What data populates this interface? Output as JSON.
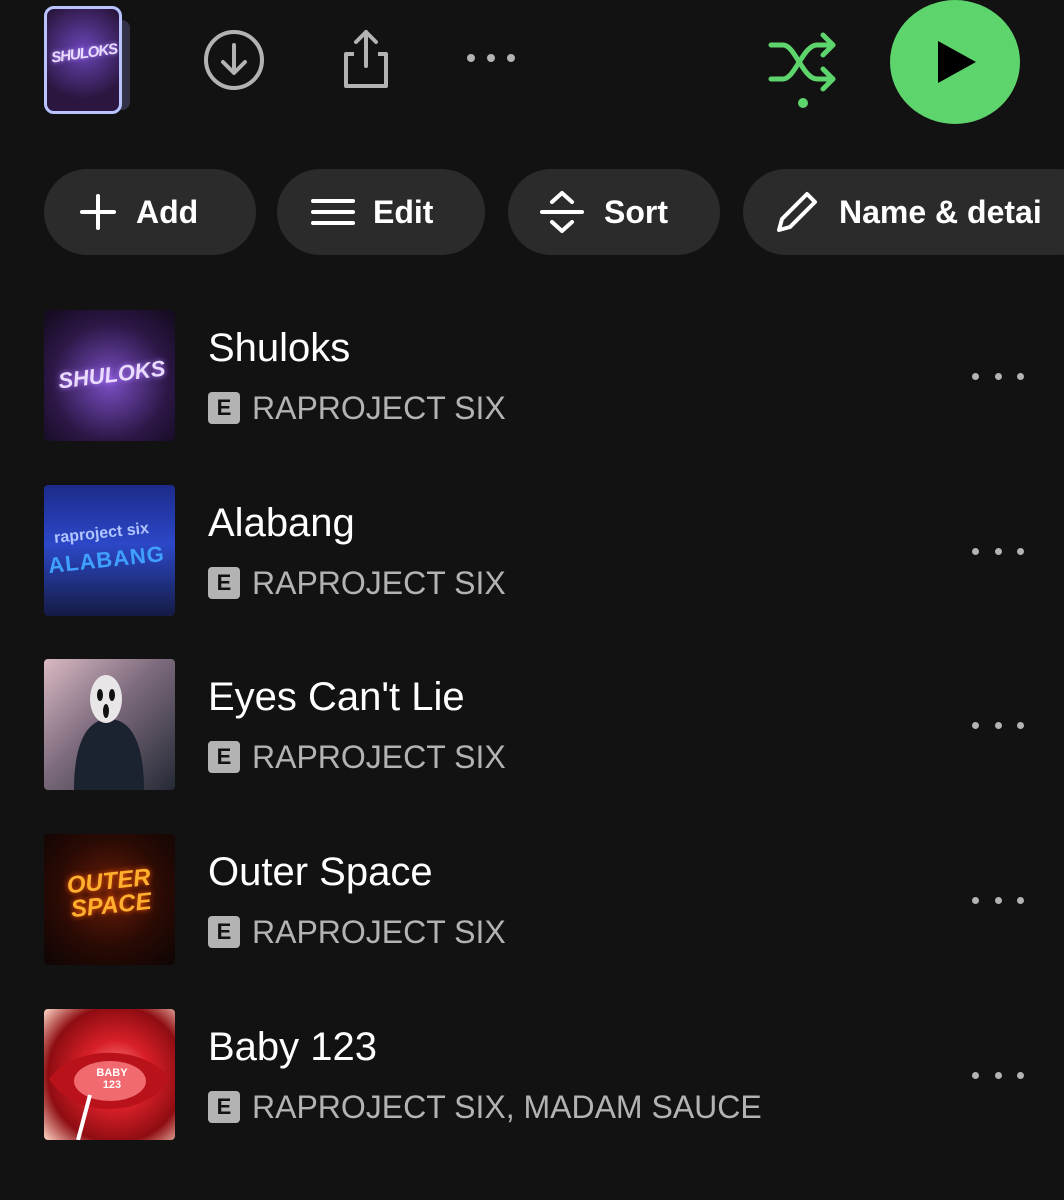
{
  "header": {
    "playlist_cover_text": "SHULOKS",
    "play_color": "#5ed46d",
    "shuffle_color": "#5ed46d"
  },
  "actions": {
    "add_label": "Add",
    "edit_label": "Edit",
    "sort_label": "Sort",
    "details_label": "Name & detai"
  },
  "tracks": [
    {
      "title": "Shuloks",
      "explicit": "E",
      "artist": "RAPROJECT SIX",
      "cover_text": "SHULOKS"
    },
    {
      "title": "Alabang",
      "explicit": "E",
      "artist": "RAPROJECT SIX",
      "cover_text": "ALABANG",
      "cover_text2": "raproject six"
    },
    {
      "title": "Eyes Can't Lie",
      "explicit": "E",
      "artist": "RAPROJECT SIX"
    },
    {
      "title": "Outer Space",
      "explicit": "E",
      "artist": "RAPROJECT SIX",
      "cover_text": "OUTER SPACE"
    },
    {
      "title": "Baby 123",
      "explicit": "E",
      "artist": "RAPROJECT SIX, MADAM SAUCE",
      "cover_text": "BABY 123"
    }
  ]
}
